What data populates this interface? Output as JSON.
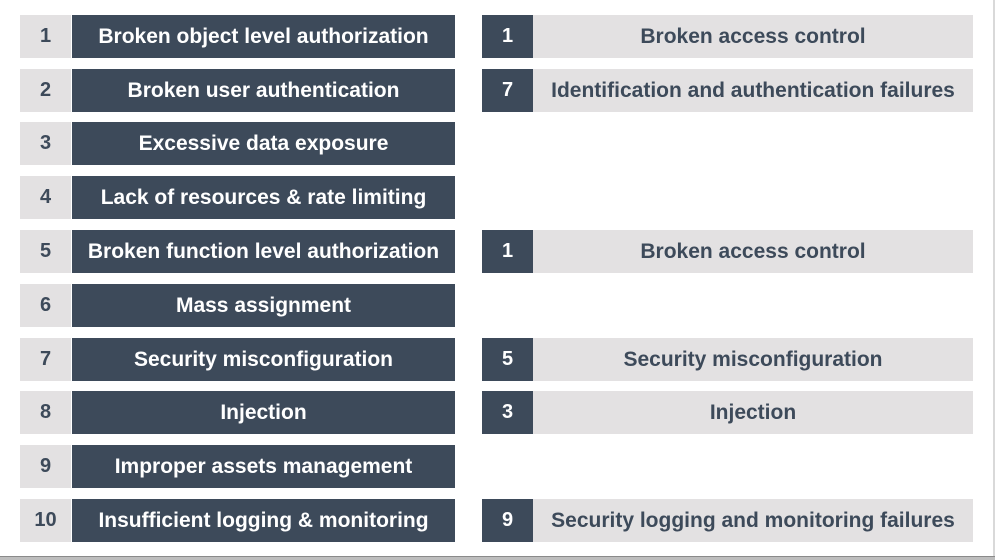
{
  "api_top10": [
    {
      "rank": "1",
      "label": "Broken object level authorization"
    },
    {
      "rank": "2",
      "label": "Broken user authentication"
    },
    {
      "rank": "3",
      "label": "Excessive data exposure"
    },
    {
      "rank": "4",
      "label": "Lack of resources & rate limiting"
    },
    {
      "rank": "5",
      "label": "Broken function level authorization"
    },
    {
      "rank": "6",
      "label": "Mass assignment"
    },
    {
      "rank": "7",
      "label": "Security misconfiguration"
    },
    {
      "rank": "8",
      "label": "Injection"
    },
    {
      "rank": "9",
      "label": "Improper assets management"
    },
    {
      "rank": "10",
      "label": "Insufficient logging & monitoring"
    }
  ],
  "web_top10_mapping": [
    {
      "row": 1,
      "rank": "1",
      "label": "Broken access control"
    },
    {
      "row": 2,
      "rank": "7",
      "label": "Identification and authentication failures"
    },
    {
      "row": 5,
      "rank": "1",
      "label": "Broken access control"
    },
    {
      "row": 7,
      "rank": "5",
      "label": "Security misconfiguration"
    },
    {
      "row": 8,
      "rank": "3",
      "label": "Injection"
    },
    {
      "row": 10,
      "rank": "9",
      "label": "Security logging and monitoring failures"
    }
  ],
  "colors": {
    "dark": "#3d4a5a",
    "light": "#e3e1e2",
    "text_on_dark": "#ffffff"
  }
}
